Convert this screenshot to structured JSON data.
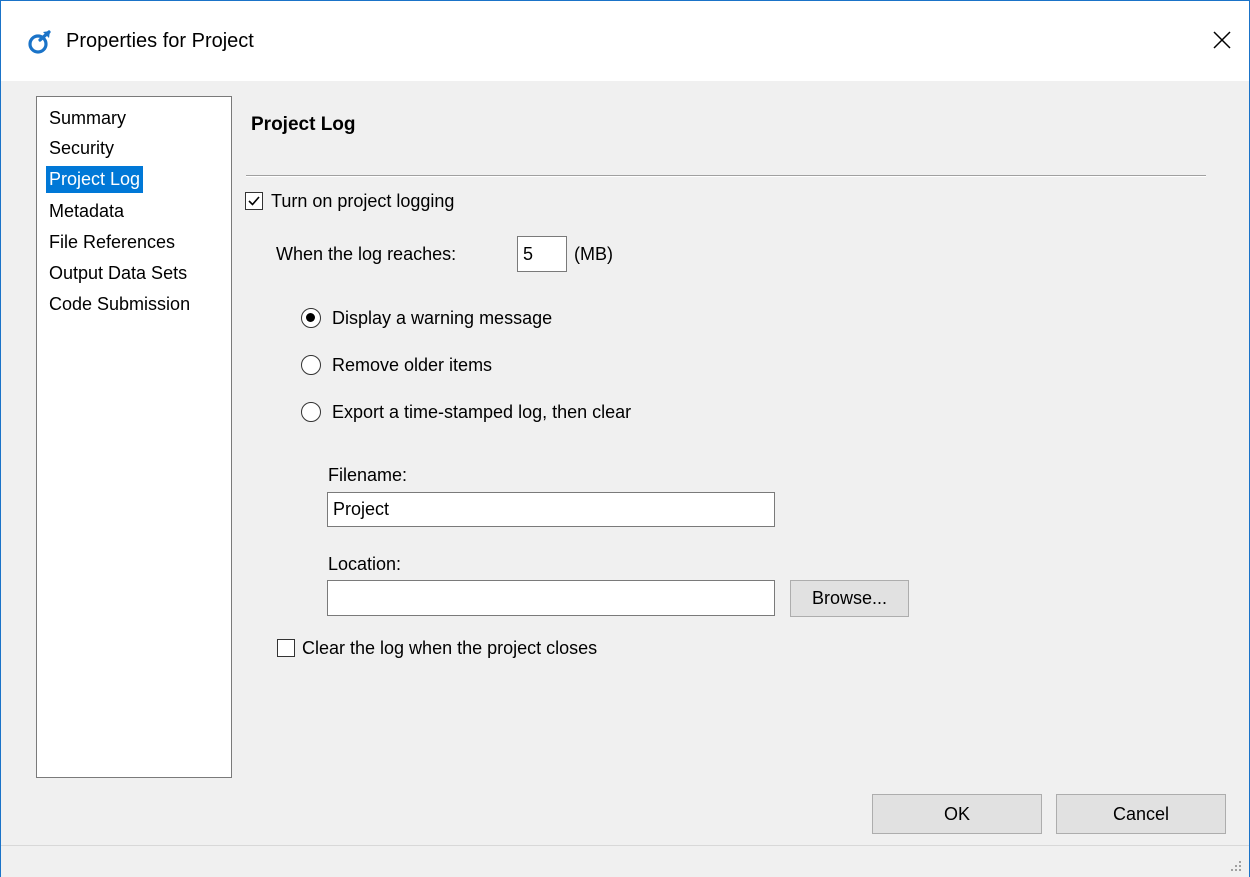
{
  "window": {
    "title": "Properties for Project"
  },
  "sidebar": {
    "items": [
      {
        "label": "Summary"
      },
      {
        "label": "Security"
      },
      {
        "label": "Project Log"
      },
      {
        "label": "Metadata"
      },
      {
        "label": "File References"
      },
      {
        "label": "Output Data Sets"
      },
      {
        "label": "Code Submission"
      }
    ],
    "selected": "Project Log"
  },
  "panel": {
    "title": "Project Log",
    "logging": {
      "label": "Turn on project logging",
      "checked": true
    },
    "size": {
      "label": "When the log reaches:",
      "value": "5",
      "unit": "(MB)"
    },
    "options": [
      {
        "label": "Display a warning message",
        "selected": true
      },
      {
        "label": "Remove older items",
        "selected": false
      },
      {
        "label": "Export a time-stamped log, then clear",
        "selected": false
      }
    ],
    "filename": {
      "label": "Filename:",
      "value": "Project"
    },
    "location": {
      "label": "Location:",
      "value": ""
    },
    "browse_label": "Browse...",
    "clear_on_close": {
      "label": "Clear the log when the project closes",
      "checked": false
    }
  },
  "footer": {
    "ok_label": "OK",
    "cancel_label": "Cancel"
  },
  "colors": {
    "accent": "#0078d7",
    "icon": "#1a73c8"
  },
  "icons": {
    "app": "app-logo-icon",
    "close": "close-icon",
    "check": "checkmark-icon",
    "grip": "resize-grip-icon"
  }
}
